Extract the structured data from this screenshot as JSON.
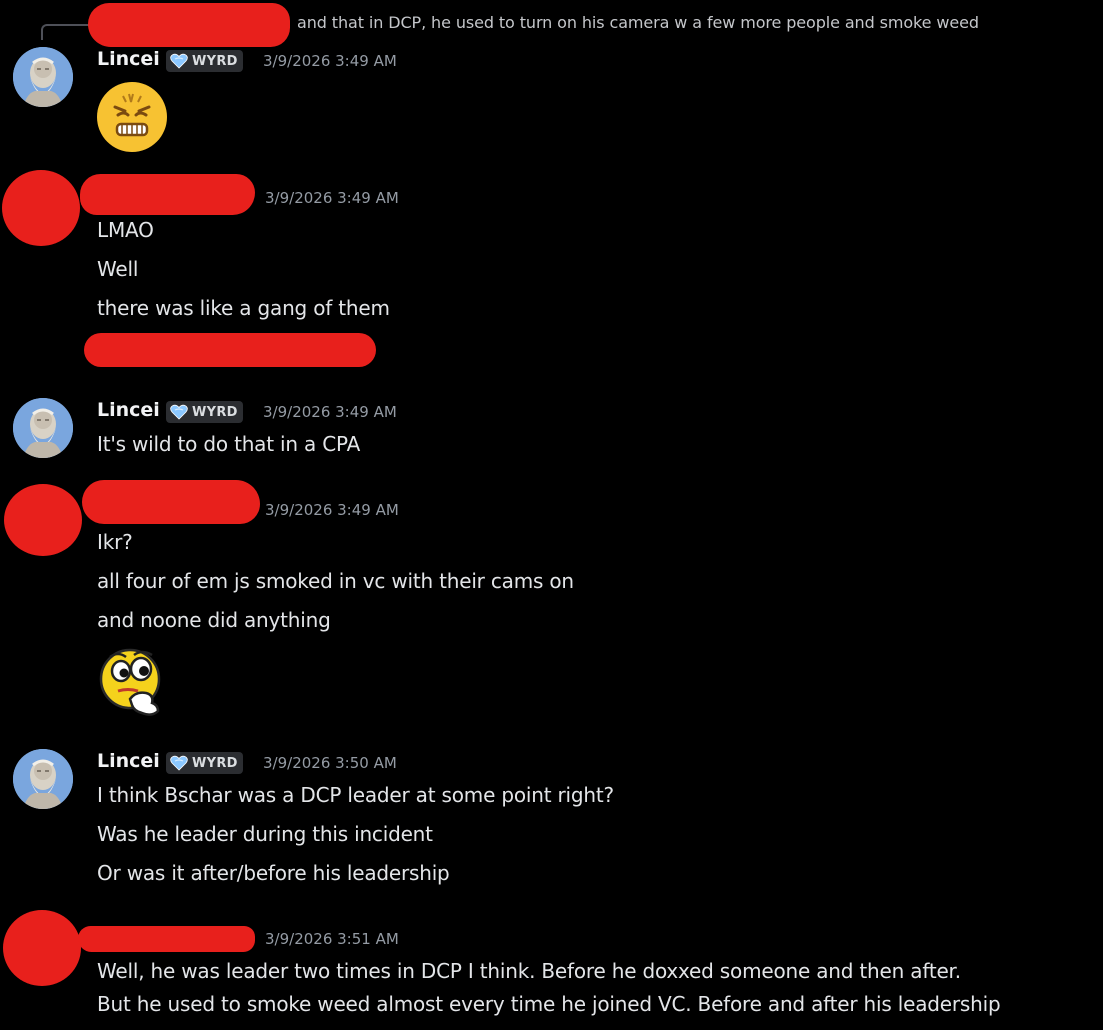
{
  "reply_preview": {
    "text": "and that in DCP, he used to turn on his camera w a few more people and smoke weed"
  },
  "colors": {
    "background": "#000000",
    "redaction": "#e8201c",
    "username": "#f2f3f5",
    "timestamp": "#949ba4",
    "message_text": "#e3e5e8"
  },
  "messages": [
    {
      "author": "Lincei",
      "tag": "WYRD",
      "tag_icon": "heart-icon",
      "timestamp": "3/9/2026 3:49 AM",
      "emoji": "sweating-grimace-emoji"
    },
    {
      "author": "[redacted]",
      "timestamp": "3/9/2026 3:49 AM",
      "lines": [
        "LMAO",
        "Well",
        "there was like a gang of them"
      ]
    },
    {
      "author": "Lincei",
      "tag": "WYRD",
      "tag_icon": "heart-icon",
      "timestamp": "3/9/2026 3:49 AM",
      "lines": [
        "It's wild to do that in a CPA"
      ]
    },
    {
      "author": "[redacted]",
      "timestamp": "3/9/2026 3:49 AM",
      "lines": [
        "Ikr?",
        "all four of em js smoked in vc with their cams on",
        "and noone did anything"
      ],
      "emoji": "thinking-face-emoji"
    },
    {
      "author": "Lincei",
      "tag": "WYRD",
      "tag_icon": "heart-icon",
      "timestamp": "3/9/2026 3:50 AM",
      "lines": [
        "I think Bschar was a DCP leader at some point right?",
        "Was he leader during this incident",
        "Or was it after/before his leadership"
      ]
    },
    {
      "author": "[redacted]",
      "timestamp": "3/9/2026 3:51 AM",
      "lines": [
        "Well, he was leader two times in DCP I think. Before he doxxed someone and then after.",
        "But he used to smoke weed almost every time he joined VC. Before and after his leadership"
      ]
    }
  ]
}
